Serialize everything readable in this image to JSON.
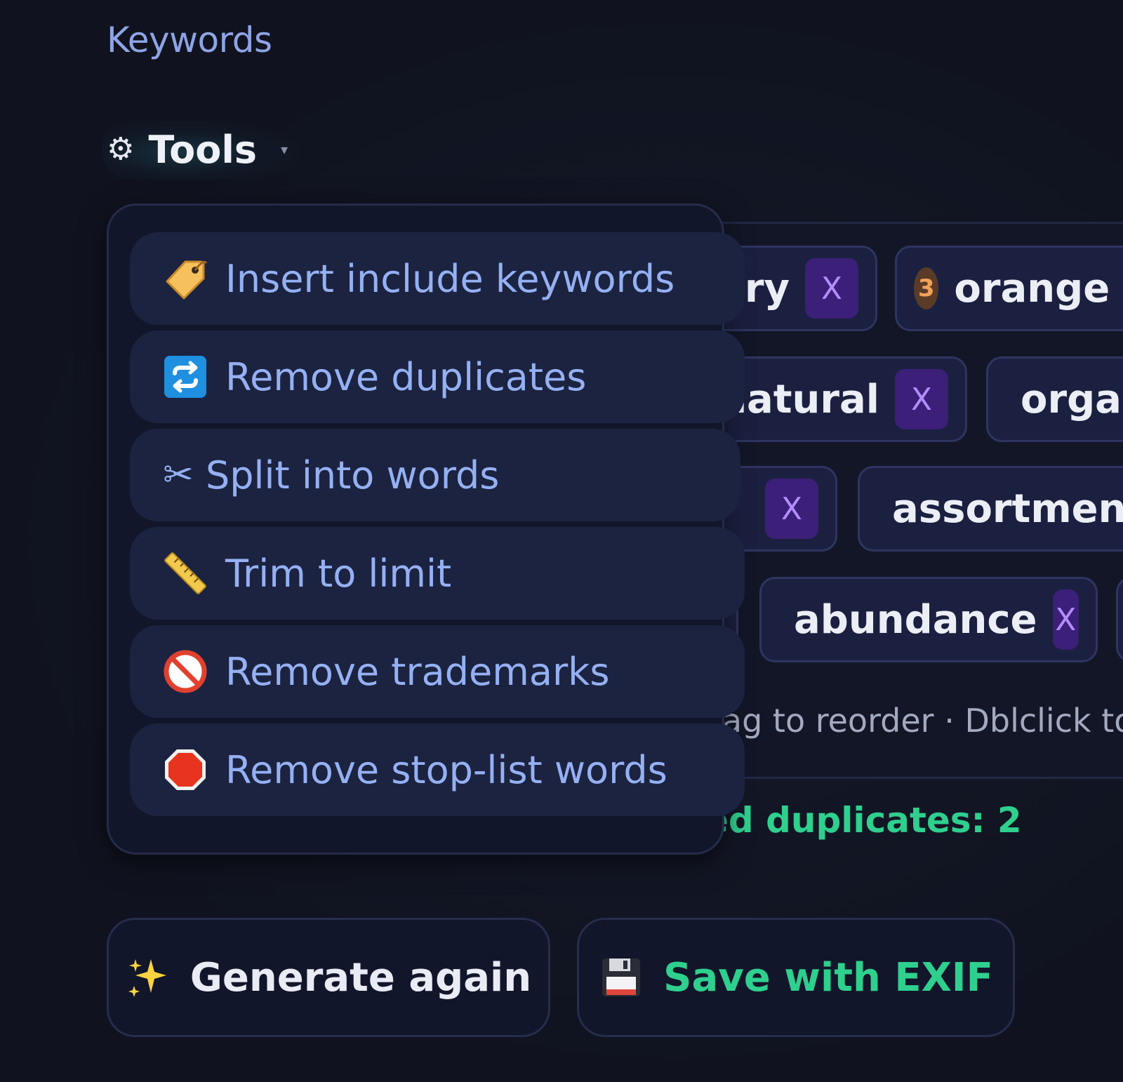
{
  "section": {
    "label": "Keywords"
  },
  "tools": {
    "icon": "gear-icon",
    "gear_glyph": "⚙",
    "label": "Tools",
    "caret": "▾"
  },
  "keywords": {
    "chips": [
      {
        "text": "rry",
        "remove": "X"
      },
      {
        "text": "orange",
        "count": "3",
        "remove": ""
      },
      {
        "text": "natural",
        "remove": "X"
      },
      {
        "text": "organ",
        "remove": ""
      },
      {
        "text": "",
        "remove": "X"
      },
      {
        "text": "assortment",
        "remove": ""
      },
      {
        "text": "abundance",
        "remove": "X"
      }
    ],
    "hint": "rag to reorder · Dblclick to",
    "status": "ed duplicates: 2"
  },
  "menu": {
    "items": [
      {
        "label": "Insert include keywords",
        "icon": "tag-icon"
      },
      {
        "label": "Remove duplicates",
        "icon": "repeat-icon"
      },
      {
        "label": "Split into words",
        "icon": "scissors-icon",
        "glyph": "✂"
      },
      {
        "label": "Trim to limit",
        "icon": "ruler-icon"
      },
      {
        "label": "Remove trademarks",
        "icon": "prohibited-icon"
      },
      {
        "label": "Remove stop-list words",
        "icon": "stop-sign-icon"
      }
    ]
  },
  "buttons": {
    "generate": {
      "label": "Generate again",
      "icon": "sparkles-icon"
    },
    "save": {
      "label": "Save with EXIF",
      "icon": "floppy-disk-icon"
    }
  },
  "colors": {
    "background": "#10131f",
    "menu_text": "#95b0f3",
    "accent_green": "#2fcf8e",
    "chip_remove": "#3b1f78",
    "label_blue": "#8ea4e4"
  }
}
